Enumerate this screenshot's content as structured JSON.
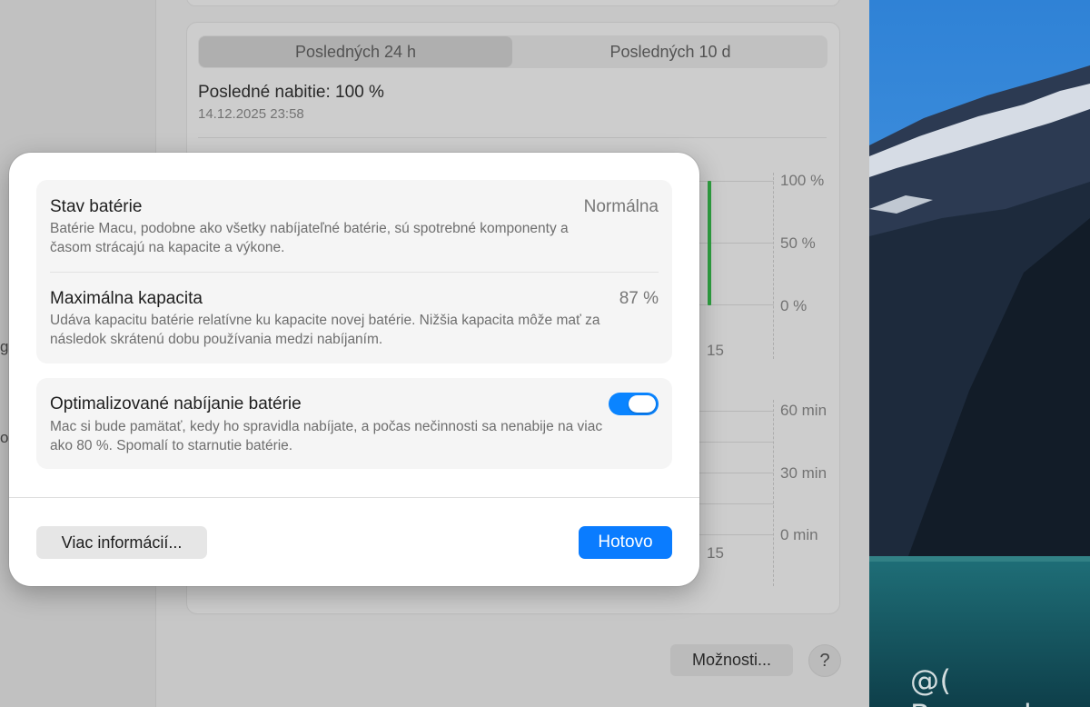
{
  "background": {
    "segmented": {
      "active": "Posledných 24 h",
      "other": "Posledných 10 d"
    },
    "last_charge": {
      "label": "Posledné nabitie: 100 %",
      "date": "14.12.2025 23:58"
    },
    "chart_level": {
      "ticks": [
        "100 %",
        "50 %",
        "0 %"
      ],
      "x_tick": "15",
      "bar_value_percent": 100
    },
    "chart_screen": {
      "ticks": [
        "60 min",
        "30 min",
        "0 min"
      ],
      "x_tick": "15"
    },
    "options_button": "Možnosti...",
    "help_button": "?",
    "sidebar_fragments": [
      "g",
      "o"
    ]
  },
  "dialog": {
    "battery_state": {
      "title": "Stav batérie",
      "value": "Normálna",
      "desc": "Batérie Macu, podobne ako všetky nabíjateľné batérie, sú spotrebné komponenty a časom strácajú na kapacite a výkone."
    },
    "max_capacity": {
      "title": "Maximálna kapacita",
      "value": "87 %",
      "desc": "Udáva kapacitu batérie relatívne ku kapacite novej batérie. Nižšia kapacita môže mať za následok skrátenú dobu používania medzi nabíjaním."
    },
    "optimized": {
      "title": "Optimalizované nabíjanie batérie",
      "desc": "Mac si bude pamätať, kedy ho spravidla nabíjate, a počas nečinnosti sa nenabije na viac ako 80 %. Spomalí to starnutie batérie.",
      "enabled": true
    },
    "more_info_button": "Viac informácií...",
    "done_button": "Hotovo"
  },
  "watermark": "@( Bazos.sk",
  "colors": {
    "accent": "#0a7cff",
    "toggle_on": "#0a84ff",
    "battery_bar": "#39c24f"
  }
}
